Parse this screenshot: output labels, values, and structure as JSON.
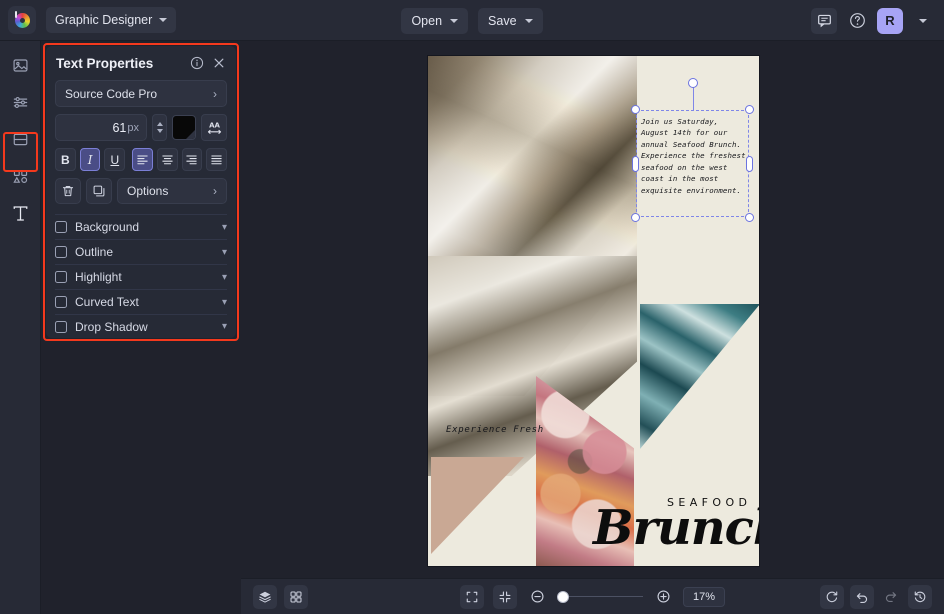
{
  "topbar": {
    "logo_icon": "color-wheel-logo",
    "document_name": "Graphic Designer",
    "open_label": "Open",
    "save_label": "Save",
    "comment_icon": "comment-icon",
    "help_icon": "help-circle-icon",
    "avatar_initial": "R",
    "accent_avatar": "#a7a4f5"
  },
  "rail": {
    "items": [
      {
        "icon": "image-icon",
        "name": "images-tool"
      },
      {
        "icon": "sliders-icon",
        "name": "adjust-tool"
      },
      {
        "icon": "layout-icon",
        "name": "layout-tool"
      },
      {
        "icon": "shapes-icon",
        "name": "elements-tool"
      },
      {
        "icon": "text-icon",
        "name": "text-tool",
        "label": "T"
      }
    ],
    "highlight_color": "#f4391d"
  },
  "panel": {
    "title": "Text Properties",
    "info_icon": "info-circle-icon",
    "close_icon": "close-icon",
    "font_family": "Source Code Pro",
    "font_size": "61",
    "font_size_unit": "px",
    "color_swatch": "#080808",
    "letter_spacing_icon": "letter-spacing-icon",
    "bold_label": "B",
    "italic_label": "I",
    "underline_label": "U",
    "align_icons": [
      "align-left-icon",
      "align-center-icon",
      "align-right-icon",
      "align-justify-icon"
    ],
    "delete_icon": "trash-icon",
    "duplicate_icon": "duplicate-icon",
    "options_label": "Options",
    "sections": [
      {
        "label": "Background",
        "checked": false
      },
      {
        "label": "Outline",
        "checked": false
      },
      {
        "label": "Highlight",
        "checked": false
      },
      {
        "label": "Curved Text",
        "checked": false
      },
      {
        "label": "Drop Shadow",
        "checked": false
      }
    ]
  },
  "canvas": {
    "selected_text": "Join us Saturday, August 14th for our annual Seafood Brunch. Experience the freshest seafood on the west coast in the most exquisite environment.",
    "tagline": "Experience Fresh",
    "logo_top": "SEAFOOD",
    "logo_main": "Brunch",
    "background_color": "#edeade",
    "tan_shape_color": "#c9a894",
    "selection_color": "#6b73e0"
  },
  "bottombar": {
    "layers_icon": "layers-icon",
    "grid_icon": "grid-icon",
    "fullscreen_icon": "fullscreen-icon",
    "fit_icon": "fit-screen-icon",
    "zoom_out_icon": "zoom-out-icon",
    "zoom_in_icon": "zoom-in-icon",
    "zoom_level": "17%",
    "reset_icon": "reset-icon",
    "undo_icon": "undo-icon",
    "redo_icon": "redo-icon",
    "history_icon": "history-icon"
  }
}
